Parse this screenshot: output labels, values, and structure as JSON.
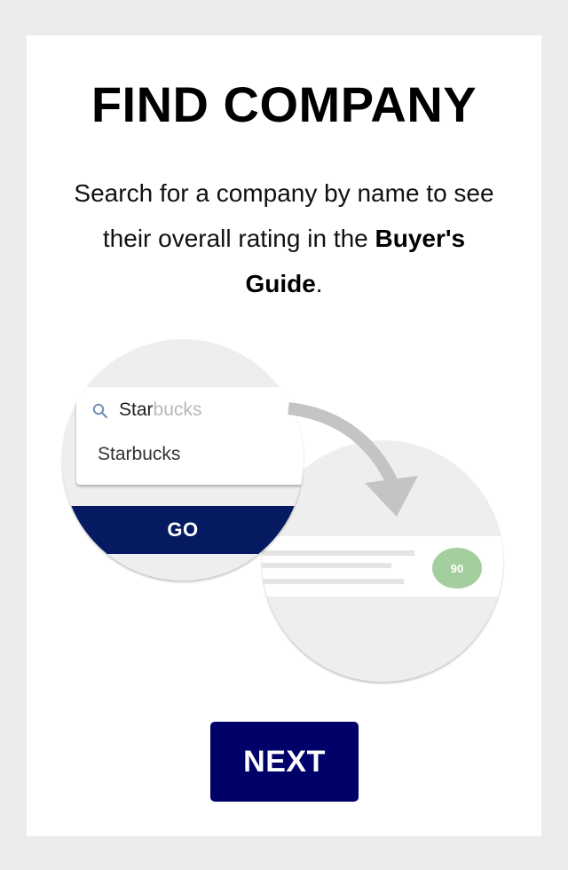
{
  "header": {
    "title": "FIND COMPANY"
  },
  "description": {
    "line_pre": "Search for a company by name to see their overall rating in the",
    "bold_term": "Buyer's Guide",
    "line_post": "."
  },
  "illustration": {
    "search": {
      "typed": "Star",
      "autocomplete_rest": "bucks",
      "suggestion": "Starbucks",
      "icon": "search-icon"
    },
    "go_label": "GO",
    "result": {
      "score": "90"
    },
    "colors": {
      "go_bar": "#051a60",
      "score_badge": "#a3cf9e",
      "arrow": "#c4c4c4"
    }
  },
  "footer": {
    "next_label": "NEXT",
    "next_color": "#01016a"
  }
}
